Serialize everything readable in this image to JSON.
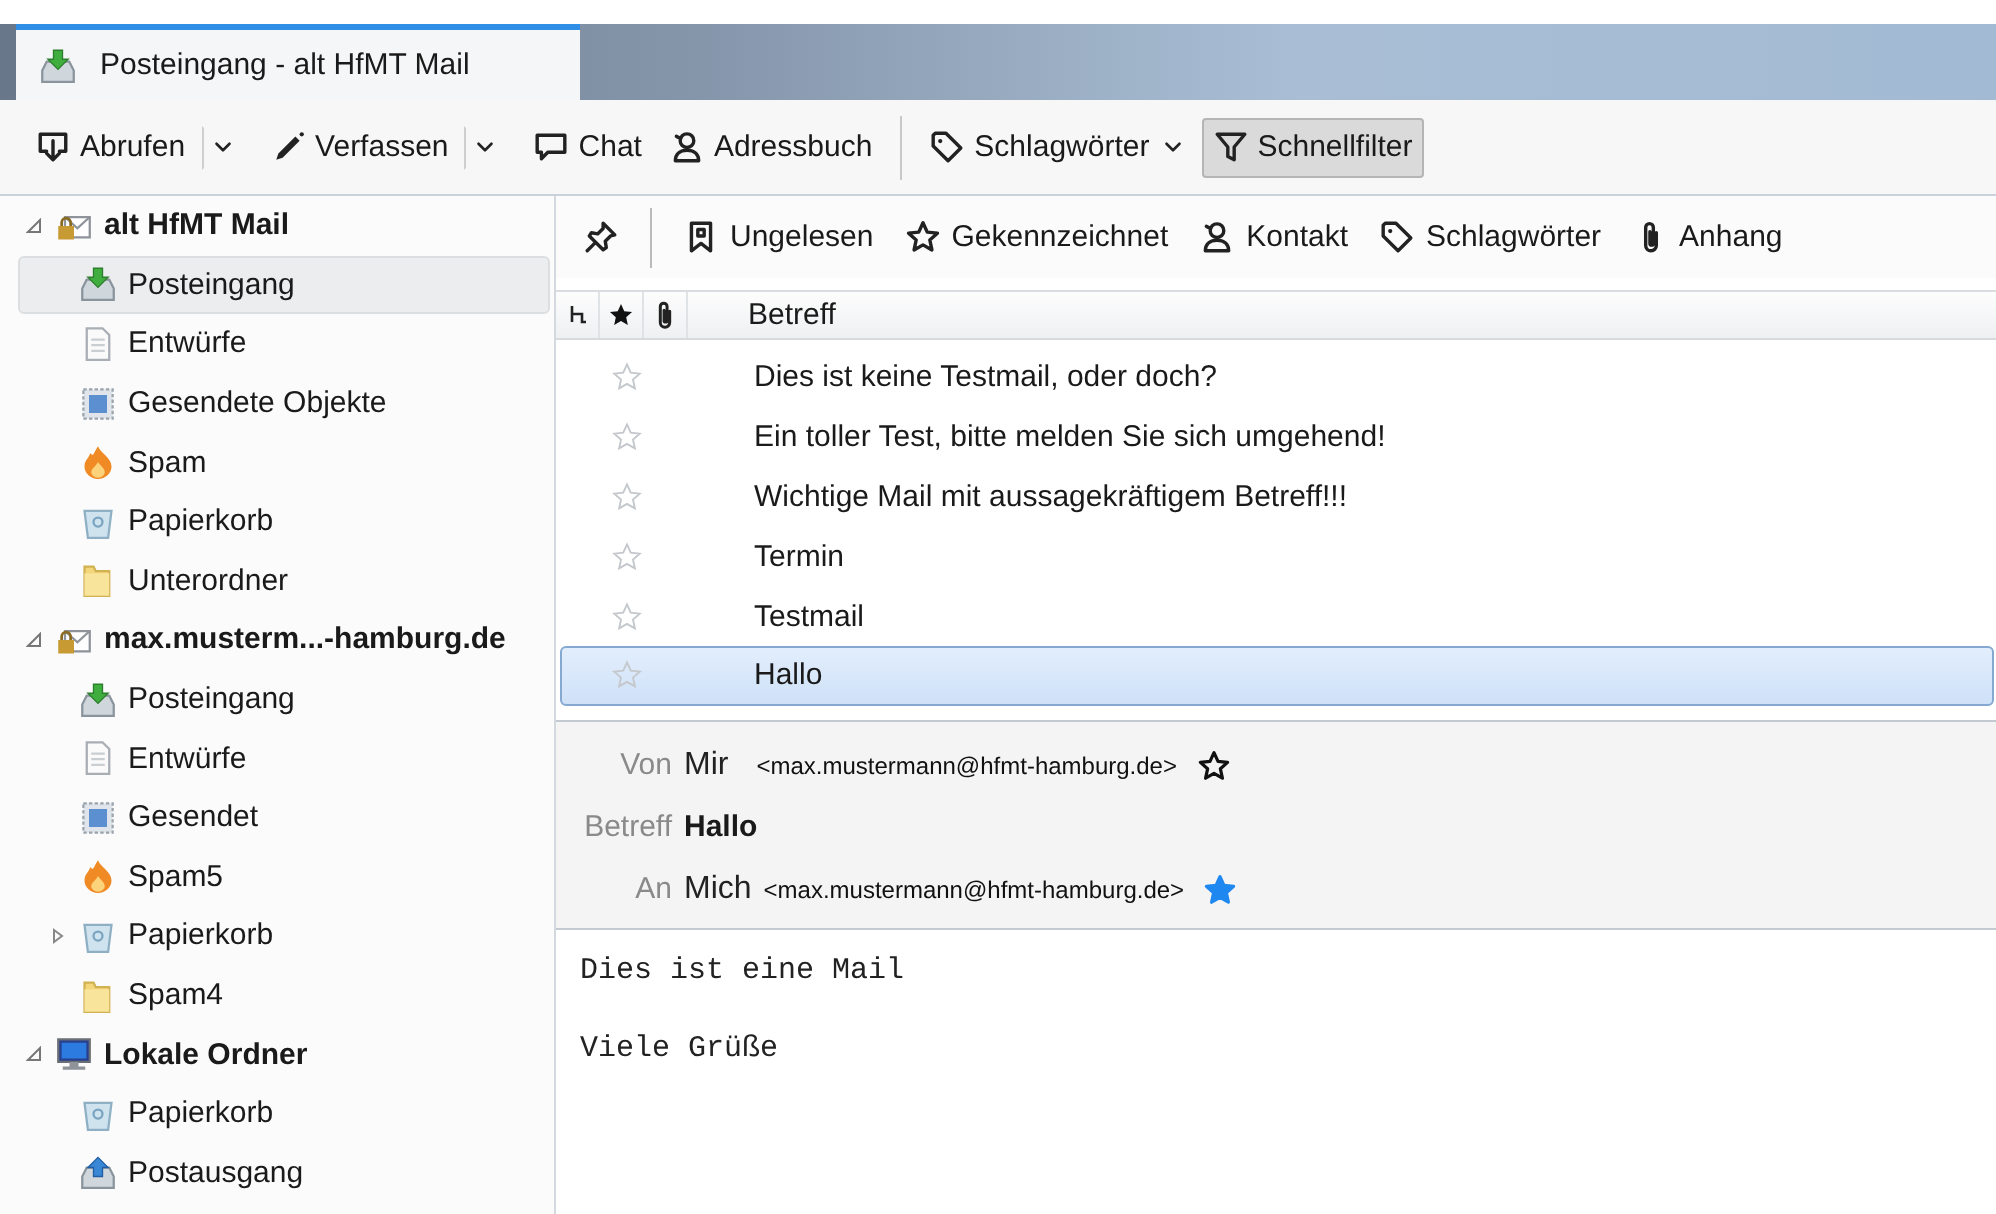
{
  "tab": {
    "title": "Posteingang - alt HfMT Mail",
    "kind": "inbox"
  },
  "toolbar": [
    {
      "kind": "button",
      "label": "Abrufen",
      "dropdown": true,
      "split": true,
      "pressed": false
    },
    {
      "kind": "button",
      "label": "Verfassen",
      "dropdown": true,
      "split": true,
      "pressed": false
    },
    {
      "kind": "button",
      "label": "Chat",
      "dropdown": false,
      "pressed": false
    },
    {
      "kind": "button",
      "label": "Adressbuch",
      "dropdown": false,
      "pressed": false
    },
    {
      "kind": "separator"
    },
    {
      "kind": "button",
      "label": "Schlagwörter",
      "dropdown": true,
      "split": false,
      "pressed": false
    },
    {
      "kind": "button",
      "label": "Schnellfilter",
      "dropdown": false,
      "pressed": true
    }
  ],
  "folders": [
    {
      "label": "alt HfMT Mail",
      "kind": "mail",
      "expanded": true,
      "selected": false,
      "children": [
        {
          "label": "Posteingang",
          "kind": "inbox",
          "selected": true
        },
        {
          "label": "Entwürfe",
          "kind": "drafts",
          "selected": false
        },
        {
          "label": "Gesendete Objekte",
          "kind": "sent",
          "selected": false
        },
        {
          "label": "Spam",
          "kind": "spam",
          "selected": false
        },
        {
          "label": "Papierkorb",
          "kind": "trash",
          "selected": false
        },
        {
          "label": "Unterordner",
          "kind": "folder",
          "selected": false
        }
      ]
    },
    {
      "label": "max.musterm...-hamburg.de",
      "kind": "mail",
      "expanded": true,
      "selected": false,
      "children": [
        {
          "label": "Posteingang",
          "kind": "inbox",
          "selected": false
        },
        {
          "label": "Entwürfe",
          "kind": "drafts",
          "selected": false
        },
        {
          "label": "Gesendet",
          "kind": "sent",
          "selected": false
        },
        {
          "label": "Spam5",
          "kind": "spam",
          "selected": false
        },
        {
          "label": "Papierkorb",
          "kind": "trash",
          "expanded": false,
          "selected": false
        },
        {
          "label": "Spam4",
          "kind": "folder",
          "selected": false
        }
      ]
    },
    {
      "label": "Lokale Ordner",
      "kind": "local",
      "expanded": true,
      "selected": false,
      "children": [
        {
          "label": "Papierkorb",
          "kind": "trash",
          "selected": false
        },
        {
          "label": "Postausgang",
          "kind": "outbox",
          "selected": false
        }
      ]
    }
  ],
  "quick_filter": [
    "Ungelesen",
    "Gekennzeichnet",
    "Kontakt",
    "Schlagwörter",
    "Anhang"
  ],
  "message_list": {
    "column_4": "Betreff",
    "rows": [
      {
        "subject": "Dies ist keine Testmail, oder doch?",
        "starred": false,
        "selected": false
      },
      {
        "subject": "Ein toller Test, bitte melden Sie sich umgehend!",
        "starred": false,
        "selected": false
      },
      {
        "subject": "Wichtige Mail mit aussagekräftigem Betreff!!!",
        "starred": false,
        "selected": false
      },
      {
        "subject": "Termin",
        "starred": false,
        "selected": false
      },
      {
        "subject": "Testmail",
        "starred": false,
        "selected": false
      },
      {
        "subject": "Hallo",
        "starred": false,
        "selected": true
      }
    ]
  },
  "message_header": {
    "fields": [
      {
        "kind": "person",
        "label": "Von",
        "name": "Mir",
        "address": "<max.mustermann@hfmt-hamburg.de>",
        "starred": false
      },
      {
        "kind": "subject",
        "label": "Betreff",
        "value": "Hallo"
      },
      {
        "kind": "person",
        "label": "An",
        "name": "Mich",
        "address": "<max.mustermann@hfmt-hamburg.de>",
        "starred": true
      }
    ]
  },
  "message_body": [
    "Dies ist eine Mail",
    "Viele Grüße"
  ]
}
